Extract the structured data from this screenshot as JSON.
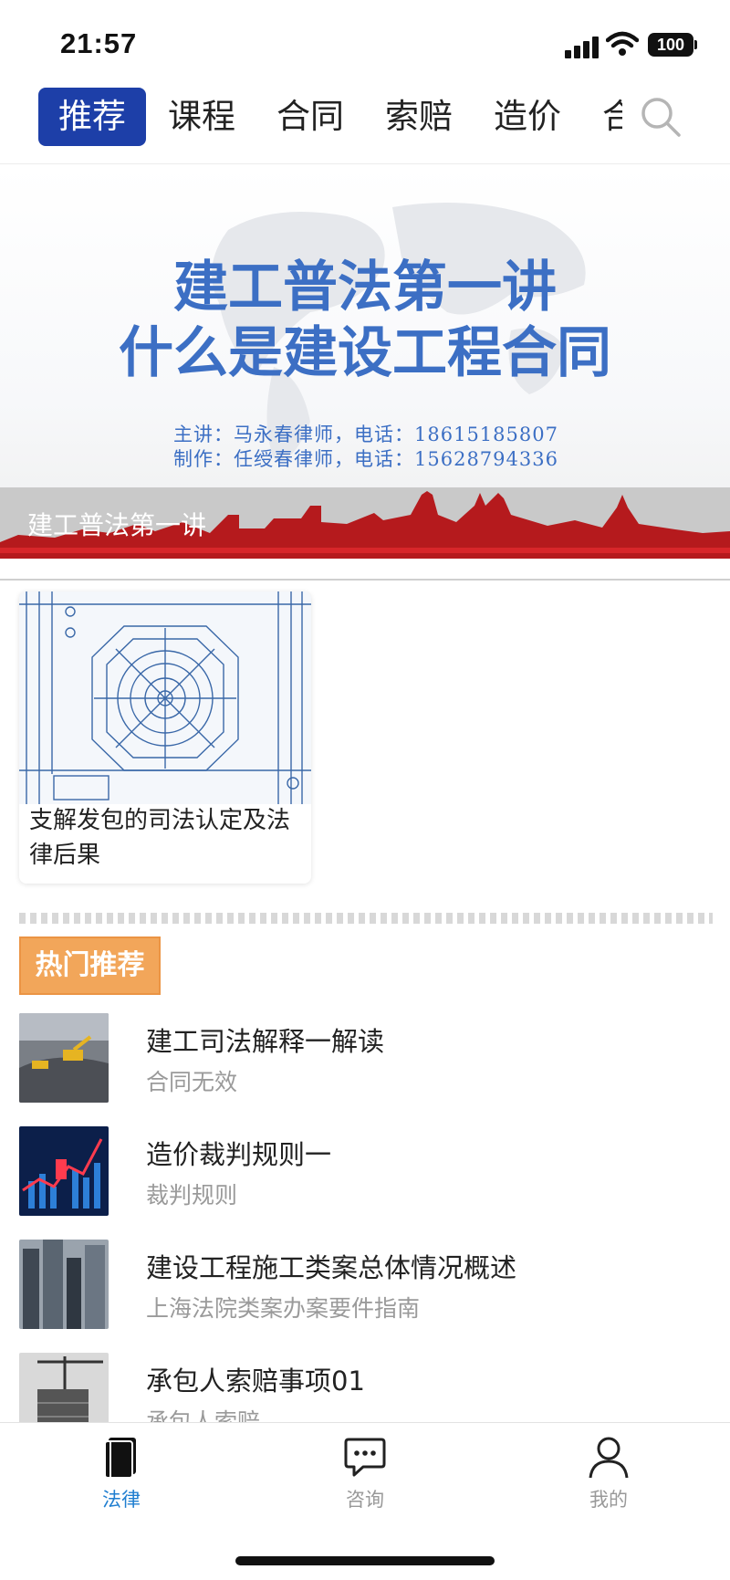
{
  "status_bar": {
    "time": "21:57",
    "battery": "100"
  },
  "tabs": [
    {
      "label": "推荐",
      "active": true
    },
    {
      "label": "课程"
    },
    {
      "label": "合同"
    },
    {
      "label": "索赔"
    },
    {
      "label": "造价"
    },
    {
      "label": "合"
    }
  ],
  "banner": {
    "title_line1": "建工普法第一讲",
    "title_line2": "什么是建设工程合同",
    "credit_line1": "主讲：马永春律师，电话：18615185807",
    "credit_line2": "制作：任绶春律师，电话：15628794336",
    "caption": "建工普法第一讲"
  },
  "featured_card": {
    "title": "支解发包的司法认定及法律后果"
  },
  "hot": {
    "badge": "热门推荐",
    "items": [
      {
        "title": "建工司法解释一解读",
        "subtitle": "合同无效"
      },
      {
        "title": "造价裁判规则一",
        "subtitle": "裁判规则"
      },
      {
        "title": "建设工程施工类案总体情况概述",
        "subtitle": "上海法院类案办案要件指南"
      },
      {
        "title": "承包人索赔事项01",
        "subtitle": "承包人索赔"
      }
    ]
  },
  "bottom_nav": [
    {
      "label": "法律",
      "icon": "book-icon",
      "active": true
    },
    {
      "label": "咨询",
      "icon": "chat-bubble-icon"
    },
    {
      "label": "我的",
      "icon": "user-icon"
    }
  ],
  "colors": {
    "accent_blue": "#1d3fa8",
    "active_nav": "#1f7ed0",
    "hot_orange": "#f2a65a",
    "banner_text": "#3c6fc4"
  }
}
